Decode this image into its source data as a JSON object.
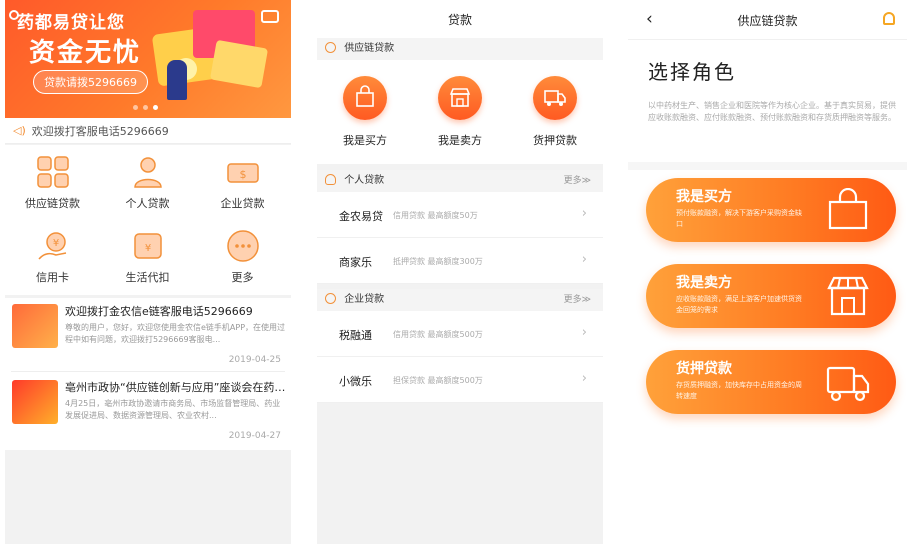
{
  "screen1": {
    "banner": {
      "line1": "药都易贷让您",
      "line2": "资金无忧",
      "pill": "贷款请拨5296669"
    },
    "notice": "欢迎拨打客服电话5296669",
    "grid": [
      {
        "label": "供应链贷款",
        "icon": "supply-chain-icon"
      },
      {
        "label": "个人贷款",
        "icon": "person-icon"
      },
      {
        "label": "企业贷款",
        "icon": "cash-icon"
      },
      {
        "label": "信用卡",
        "icon": "credit-card-icon"
      },
      {
        "label": "生活代扣",
        "icon": "wallet-icon"
      },
      {
        "label": "更多",
        "icon": "more-icon"
      }
    ],
    "news": [
      {
        "title": "欢迎拨打金农信e链客服电话5296669",
        "body": "尊敬的用户，您好，欢迎您使用金农信e链手机APP，在使用过程中如有问题，欢迎拨打5296669客服电...",
        "date": "2019-04-25"
      },
      {
        "title": "亳州市政协“供应链创新与应用”座谈会在药都...",
        "body": "4月25日，亳州市政协邀请市商务局、市场监督管理局、药业发展促进局、数据资源管理局、农业农村...",
        "date": "2019-04-27"
      }
    ]
  },
  "screen2": {
    "title": "贷款",
    "supply_chain": {
      "header": "供应链贷款",
      "buttons": [
        {
          "label": "我是买方",
          "icon": "bag-icon"
        },
        {
          "label": "我是卖方",
          "icon": "store-icon"
        },
        {
          "label": "货押贷款",
          "icon": "truck-icon"
        }
      ]
    },
    "personal": {
      "header": "个人贷款",
      "more": "更多≫",
      "rows": [
        {
          "name": "金农易贷",
          "desc": "信用贷款 最高额度50万"
        },
        {
          "name": "商家乐",
          "desc": "抵押贷款 最高额度300万"
        }
      ]
    },
    "enterprise": {
      "header": "企业贷款",
      "more": "更多≫",
      "rows": [
        {
          "name": "税融通",
          "desc": "信用贷款 最高额度500万"
        },
        {
          "name": "小微乐",
          "desc": "担保贷款 最高额度500万"
        }
      ]
    }
  },
  "screen3": {
    "title": "供应链贷款",
    "heading": "选择角色",
    "description": "以中药材生产、销售企业和医院等作为核心企业。基于真实贸易，提供应收账款融资、应付账款融资、预付账款融资和存货质押融资等服务。",
    "cards": [
      {
        "title": "我是买方",
        "desc": "预付账款融资，解决下游客户采购资金缺口",
        "icon": "bag-icon"
      },
      {
        "title": "我是卖方",
        "desc": "应收账款融资，满足上游客户加速供货资金回笼的需求",
        "icon": "store-icon"
      },
      {
        "title": "货押贷款",
        "desc": "存货质押融资，加快库存中占用资金的周转速度",
        "icon": "truck-icon"
      }
    ]
  },
  "colors": {
    "accent": "#ff6a2a",
    "accent_light": "#ffa13a"
  }
}
